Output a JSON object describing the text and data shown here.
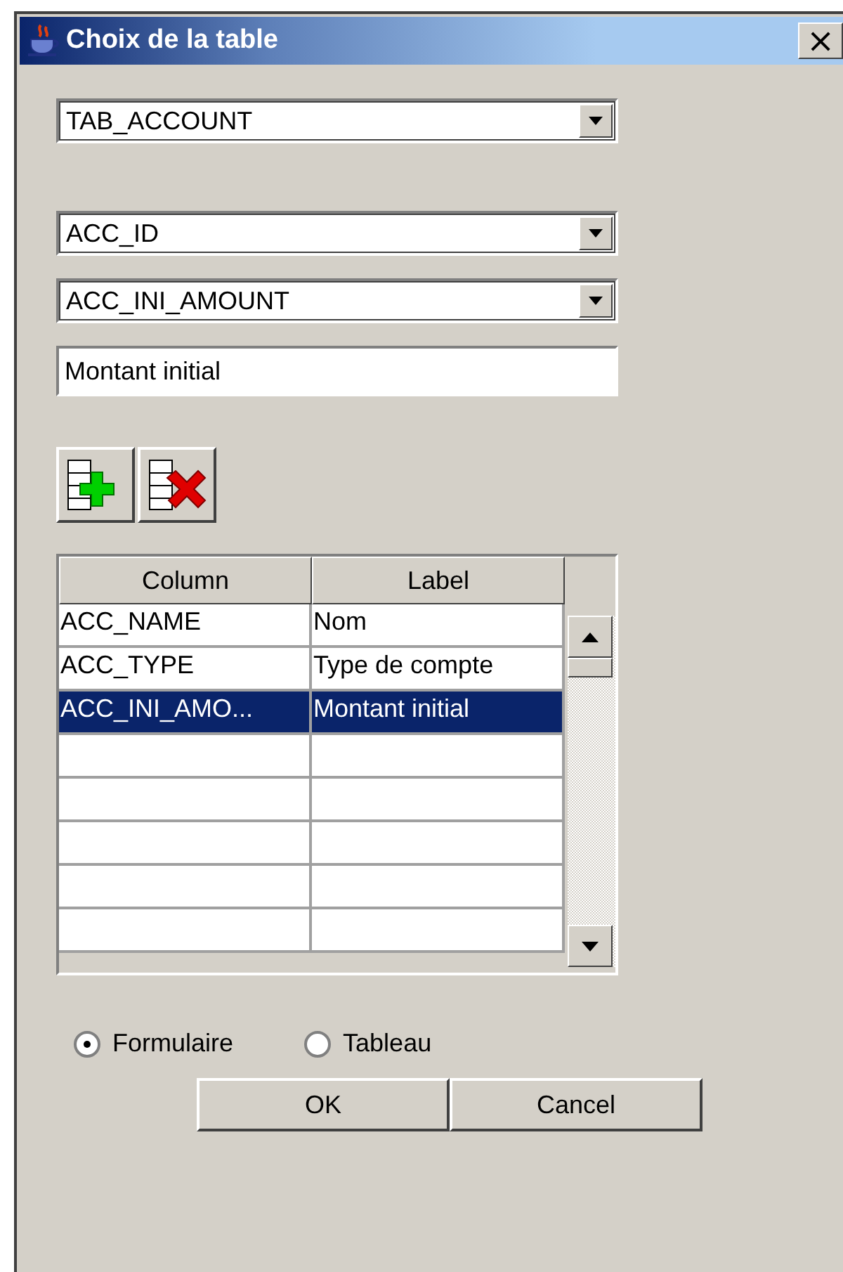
{
  "window": {
    "title": "Choix de la table",
    "close": "×"
  },
  "table_combo": {
    "value": "TAB_ACCOUNT"
  },
  "column_combo": {
    "value": "ACC_ID"
  },
  "label_combo": {
    "value": "ACC_INI_AMOUNT"
  },
  "label_field": {
    "value": "Montant initial"
  },
  "grid": {
    "columns": [
      "Column",
      "Label"
    ],
    "rows": [
      {
        "column": "ACC_NAME",
        "label": "Nom",
        "selected": false
      },
      {
        "column": "ACC_TYPE",
        "label": "Type de compte",
        "selected": false
      },
      {
        "column": "ACC_INI_AMO...",
        "label": "Montant initial",
        "selected": true
      }
    ]
  },
  "view_options": [
    {
      "label": "Formulaire",
      "selected": true
    },
    {
      "label": "Tableau",
      "selected": false
    }
  ],
  "buttons": [
    "OK",
    "Cancel"
  ]
}
